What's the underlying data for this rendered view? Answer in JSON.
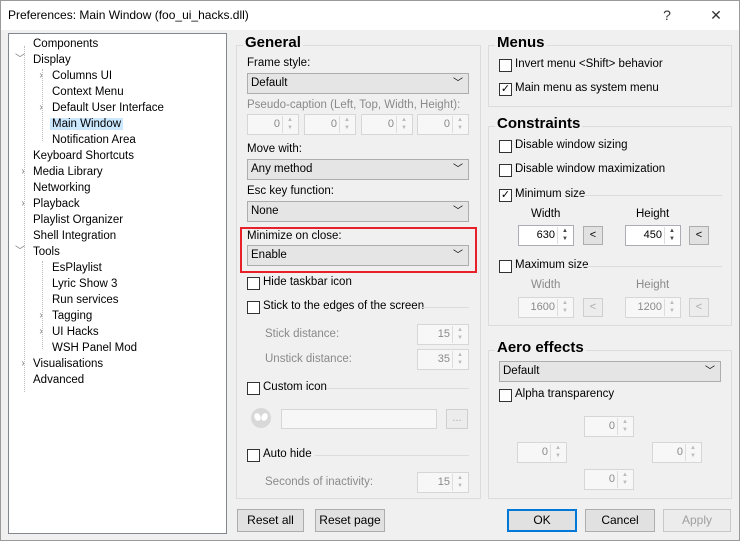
{
  "window": {
    "title": "Preferences: Main Window (foo_ui_hacks.dll)",
    "help_glyph": "?",
    "close_glyph": "✕"
  },
  "tree": {
    "items": [
      {
        "label": "Components",
        "expander": "",
        "selected": false
      },
      {
        "label": "Display",
        "expander": "open",
        "selected": false
      },
      {
        "label": "Columns UI",
        "expander": "closed",
        "selected": false
      },
      {
        "label": "Context Menu",
        "expander": "",
        "selected": false
      },
      {
        "label": "Default User Interface",
        "expander": "closed",
        "selected": false
      },
      {
        "label": "Main Window",
        "expander": "",
        "selected": true
      },
      {
        "label": "Notification Area",
        "expander": "",
        "selected": false
      },
      {
        "label": "Keyboard Shortcuts",
        "expander": "",
        "selected": false
      },
      {
        "label": "Media Library",
        "expander": "closed",
        "selected": false
      },
      {
        "label": "Networking",
        "expander": "",
        "selected": false
      },
      {
        "label": "Playback",
        "expander": "closed",
        "selected": false
      },
      {
        "label": "Playlist Organizer",
        "expander": "",
        "selected": false
      },
      {
        "label": "Shell Integration",
        "expander": "",
        "selected": false
      },
      {
        "label": "Tools",
        "expander": "open",
        "selected": false
      },
      {
        "label": "EsPlaylist",
        "expander": "",
        "selected": false
      },
      {
        "label": "Lyric Show 3",
        "expander": "",
        "selected": false
      },
      {
        "label": "Run services",
        "expander": "",
        "selected": false
      },
      {
        "label": "Tagging",
        "expander": "closed",
        "selected": false
      },
      {
        "label": "UI Hacks",
        "expander": "closed",
        "selected": false
      },
      {
        "label": "WSH Panel Mod",
        "expander": "",
        "selected": false
      },
      {
        "label": "Visualisations",
        "expander": "closed",
        "selected": false
      },
      {
        "label": "Advanced",
        "expander": "",
        "selected": false
      }
    ]
  },
  "general": {
    "heading": "General",
    "frame_style_label": "Frame style:",
    "frame_style_value": "Default",
    "pseudo_caption_label": "Pseudo-caption (Left, Top, Width, Height):",
    "pseudo_values": [
      "0",
      "0",
      "0",
      "0"
    ],
    "move_with_label": "Move with:",
    "move_with_value": "Any method",
    "esc_label": "Esc key function:",
    "esc_value": "None",
    "minimize_label": "Minimize on close:",
    "minimize_value": "Enable",
    "hide_taskbar_label": "Hide taskbar icon",
    "stick_label": "Stick to the edges of the screen",
    "stick_distance_label": "Stick distance:",
    "stick_distance_value": "15",
    "unstick_distance_label": "Unstick distance:",
    "unstick_distance_value": "35",
    "custom_icon_label": "Custom icon",
    "browse_label": "...",
    "auto_hide_label": "Auto hide",
    "seconds_label": "Seconds of inactivity:",
    "seconds_value": "15"
  },
  "menus": {
    "heading": "Menus",
    "invert_label": "Invert menu <Shift> behavior",
    "invert_checked": false,
    "system_menu_label": "Main menu as system menu",
    "system_menu_checked": true
  },
  "constraints": {
    "heading": "Constraints",
    "disable_sizing_label": "Disable window sizing",
    "disable_max_label": "Disable window maximization",
    "min_size_label": "Minimum size",
    "min_size_checked": true,
    "width_label": "Width",
    "height_label": "Height",
    "min_width": "630",
    "min_height": "450",
    "pick_glyph": "<",
    "max_size_label": "Maximum size",
    "max_width": "1600",
    "max_height": "1200"
  },
  "aero": {
    "heading": "Aero effects",
    "mode_value": "Default",
    "alpha_label": "Alpha transparency",
    "top": "0",
    "left": "0",
    "right": "0",
    "bottom": "0"
  },
  "buttons": {
    "reset_all": "Reset all",
    "reset_page": "Reset page",
    "ok": "OK",
    "cancel": "Cancel",
    "apply": "Apply"
  },
  "colors": {
    "selection": "#cce8ff",
    "highlight_box": "#e8202a",
    "default_button_border": "#0078d7"
  }
}
